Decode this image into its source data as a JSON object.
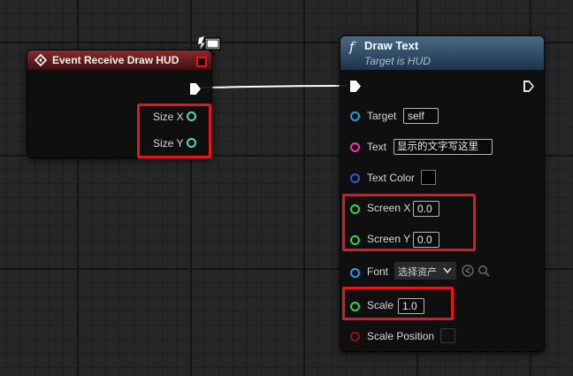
{
  "event_node": {
    "title": "Event Receive Draw HUD",
    "pins": [
      {
        "label": "Size X"
      },
      {
        "label": "Size Y"
      }
    ]
  },
  "draw_text_node": {
    "title": "Draw Text",
    "subtitle": "Target is HUD",
    "function_glyph": "f",
    "pins": [
      {
        "label": "Target",
        "value": "self"
      },
      {
        "label": "Text",
        "value": "显示的文字写这里"
      },
      {
        "label": "Text Color"
      },
      {
        "label": "Screen X",
        "value": "0.0"
      },
      {
        "label": "Screen Y",
        "value": "0.0"
      },
      {
        "label": "Font",
        "value": "选择资产"
      },
      {
        "label": "Scale",
        "value": "1.0"
      },
      {
        "label": "Scale Position"
      }
    ]
  },
  "pin_colors": {
    "object": "#1f9fe6",
    "text": "#e83ab8",
    "struct": "#1f5fd6",
    "float": "#35d24a",
    "bool": "#8c1414",
    "event_pins": "#4fd6c3"
  },
  "highlight_color": "#e01620"
}
